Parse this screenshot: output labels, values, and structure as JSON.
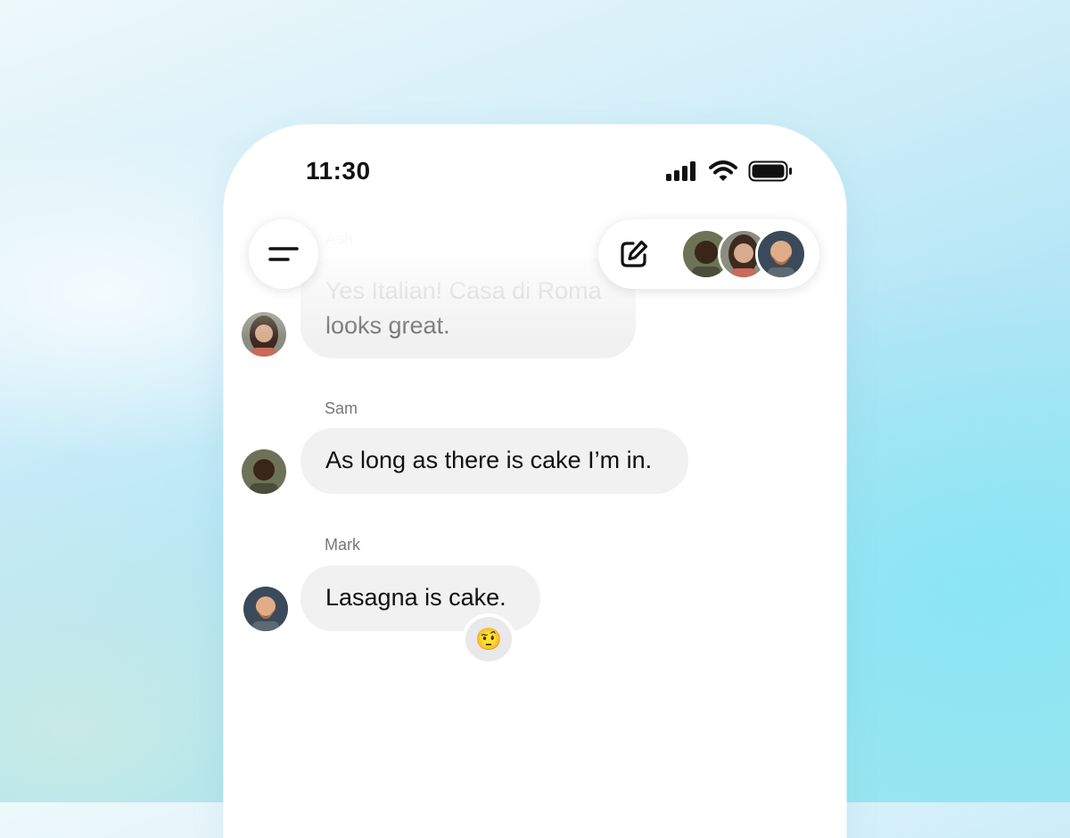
{
  "status_bar": {
    "time": "11:30",
    "icons": [
      "signal-icon",
      "wifi-icon",
      "battery-icon"
    ]
  },
  "header": {
    "menu_icon": "menu-icon",
    "compose_icon": "compose-icon",
    "participants": [
      "Sam",
      "Ash",
      "Mark"
    ]
  },
  "messages": [
    {
      "sender": "Ash",
      "lines": [
        "Yes Italian! Casa di Roma",
        "looks great."
      ]
    },
    {
      "sender": "Sam",
      "text": "As long as there is cake I’m in."
    },
    {
      "sender": "Mark",
      "text": "Lasagna is cake.",
      "reaction": "🤨"
    }
  ],
  "colors": {
    "bubble": "#f1f1f2",
    "text": "#111111",
    "sender_label": "#777777"
  }
}
